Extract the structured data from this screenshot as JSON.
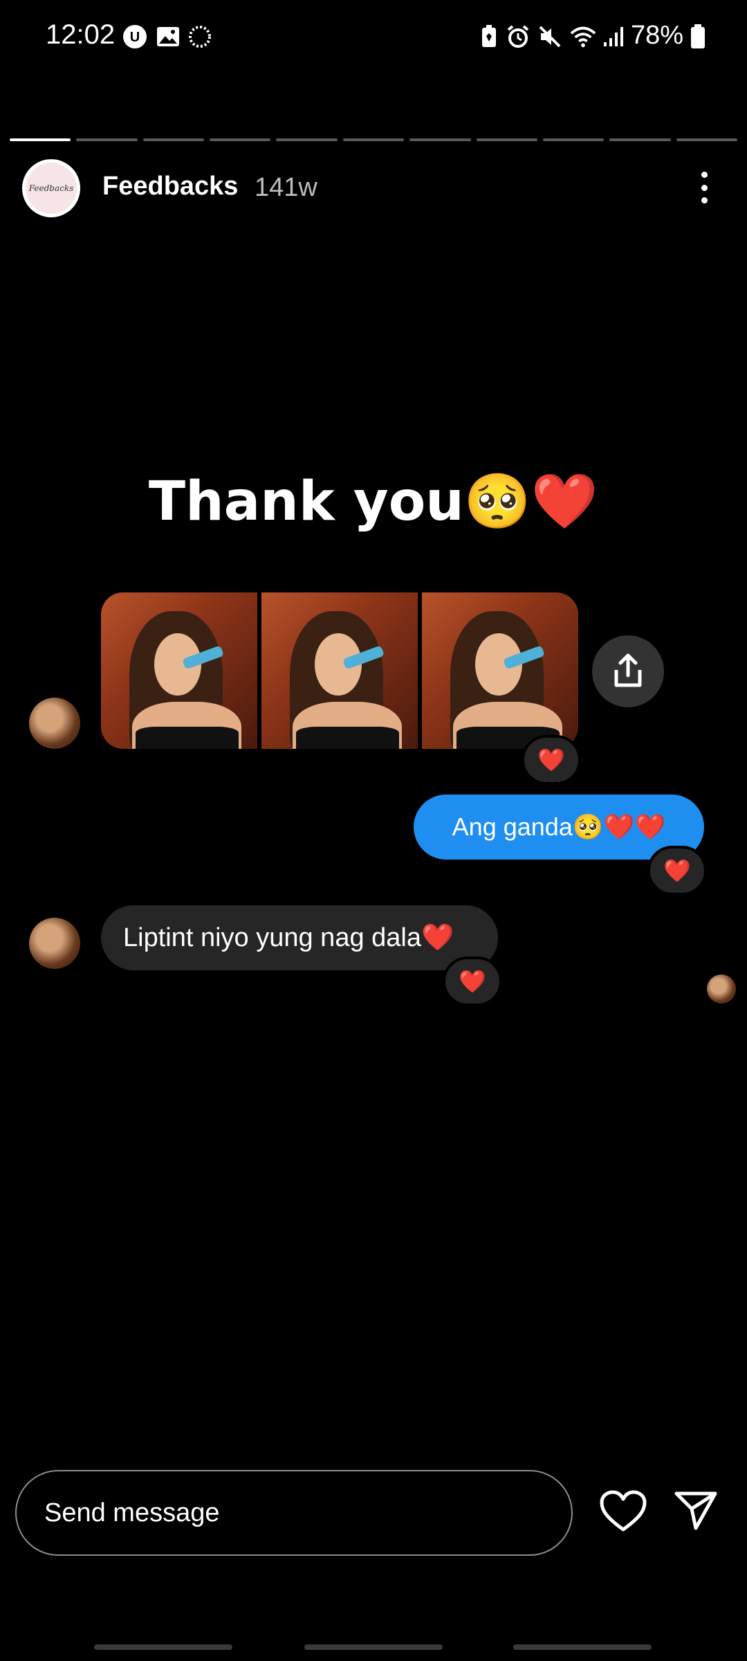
{
  "status_bar": {
    "time": "12:02",
    "battery": "78%"
  },
  "story": {
    "username": "Feedbacks",
    "time_ago": "141w",
    "avatar_text": "Feedbacks",
    "progress_segments": 11,
    "active_segment": 1
  },
  "content": {
    "thank_you": "Thank you🥺❤️",
    "photo_reaction": "❤️",
    "outgoing_message": "Ang ganda🥺❤️❤️",
    "outgoing_reaction": "❤️",
    "incoming_message": "Liptint niyo yung nag dala❤️",
    "incoming_reaction": "❤️"
  },
  "composer": {
    "placeholder": "Send message"
  },
  "colors": {
    "bubble_blue": "#1f8ef1",
    "bubble_gray": "#262626",
    "heart": "#ff2f40"
  }
}
